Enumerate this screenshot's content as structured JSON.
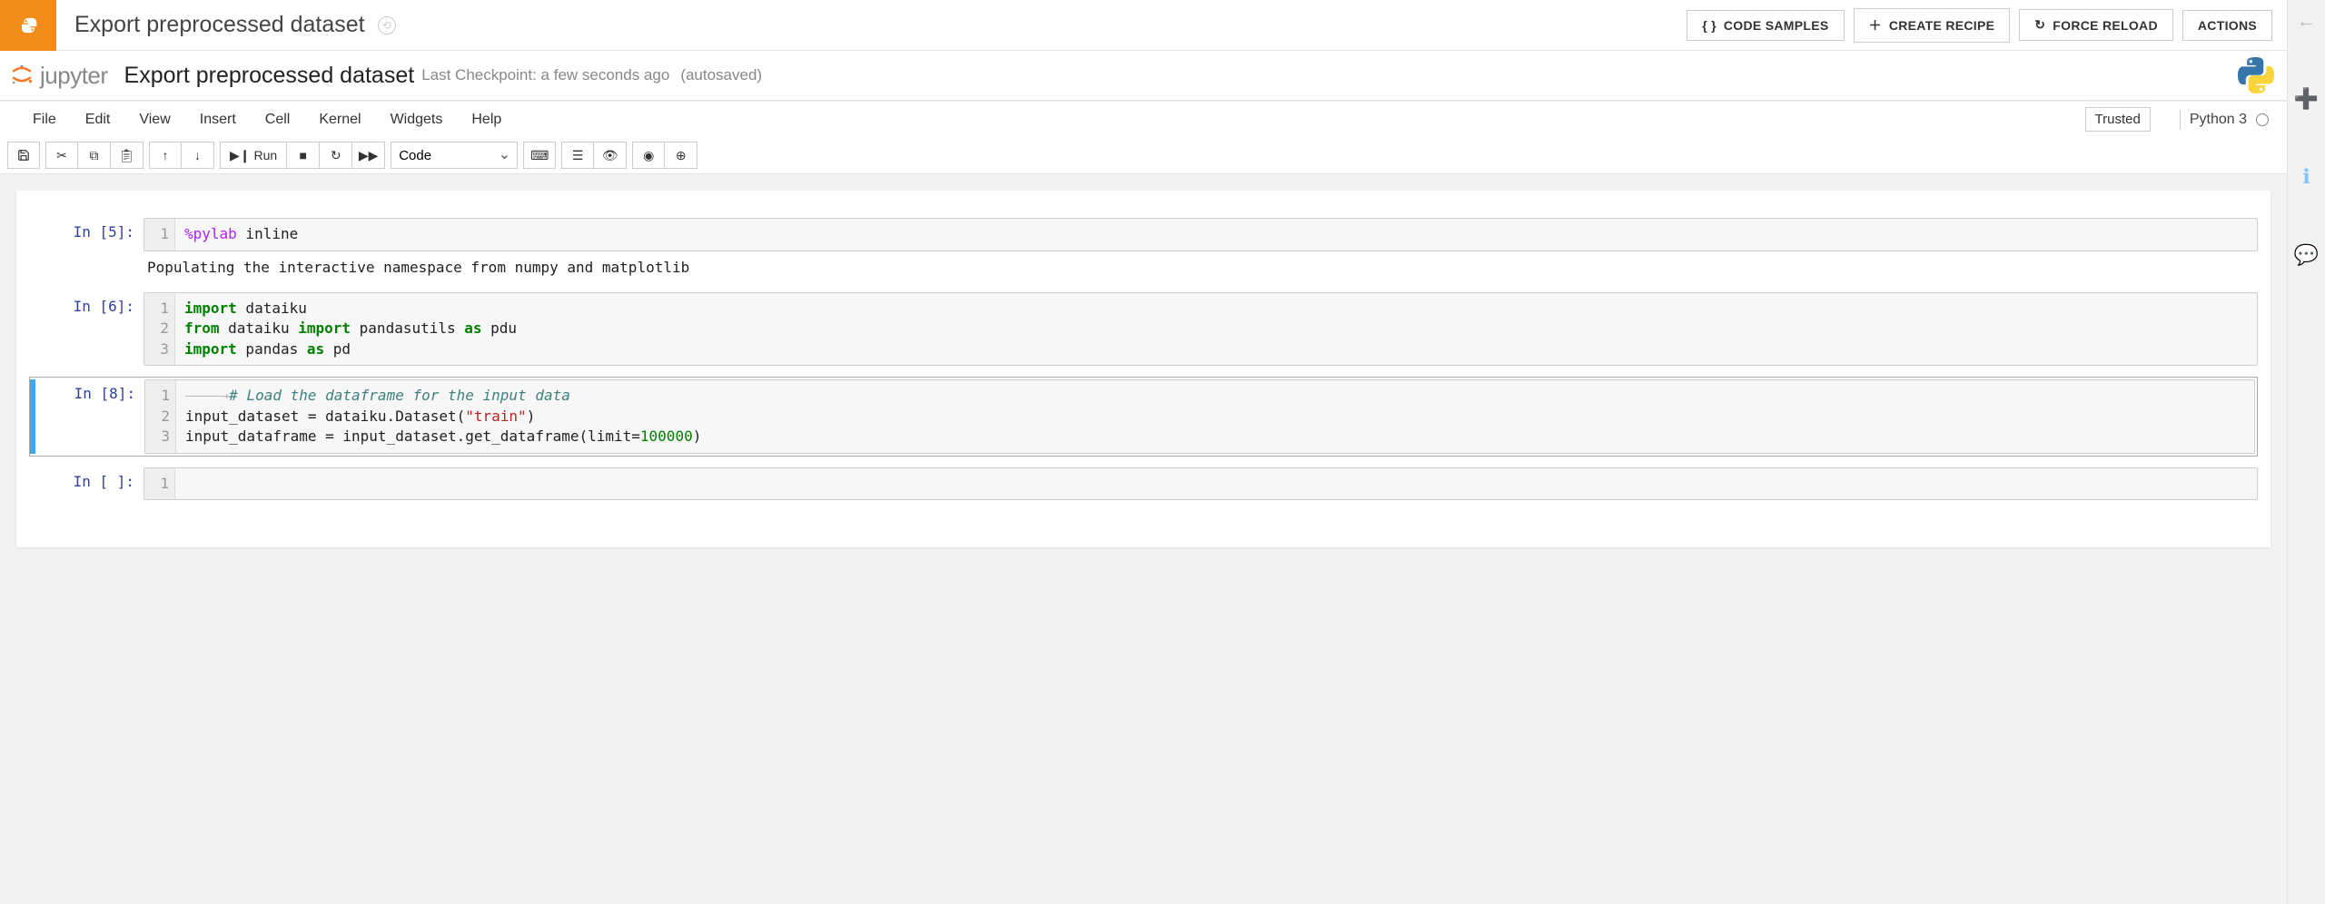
{
  "topbar": {
    "title": "Export preprocessed dataset",
    "buttons": {
      "code_samples": "CODE SAMPLES",
      "create_recipe": "CREATE RECIPE",
      "force_reload": "FORCE RELOAD",
      "actions": "ACTIONS"
    }
  },
  "jupyter": {
    "logo_text": "jupyter",
    "notebook_title": "Export preprocessed dataset",
    "checkpoint": "Last Checkpoint: a few seconds ago",
    "autosaved": "(autosaved)"
  },
  "menubar": {
    "items": [
      "File",
      "Edit",
      "View",
      "Insert",
      "Cell",
      "Kernel",
      "Widgets",
      "Help"
    ],
    "trusted": "Trusted",
    "kernel": "Python 3"
  },
  "toolbar": {
    "run_label": "Run",
    "cell_type_selected": "Code"
  },
  "cells": [
    {
      "prompt": "In [5]:",
      "gutter": [
        "1"
      ],
      "code_html": "<span class='cm-magic'>%pylab</span> inline",
      "output": "Populating the interactive namespace from numpy and matplotlib"
    },
    {
      "prompt": "In [6]:",
      "gutter": [
        "1",
        "2",
        "3"
      ],
      "code_html": "<span class='cm-kw'>import</span> dataiku\n<span class='cm-kw'>from</span> dataiku <span class='cm-kw'>import</span> pandasutils <span class='cm-kw'>as</span> pdu\n<span class='cm-kw'>import</span> pandas <span class='cm-kw'>as</span> pd"
    },
    {
      "prompt": "In [8]:",
      "selected": true,
      "gutter": [
        "1",
        "2",
        "3"
      ],
      "code_html": "<span class='cm-tab-arrow'>――――→</span><span class='cm-comment'># Load the dataframe for the input data</span>\ninput_dataset = dataiku.Dataset(<span class='cm-str'>\"train\"</span>)\ninput_dataframe = input_dataset.get_dataframe(limit=<span class='cm-num'>100000</span>)"
    },
    {
      "prompt": "In [ ]:",
      "gutter": [
        "1"
      ],
      "code_html": ""
    }
  ]
}
